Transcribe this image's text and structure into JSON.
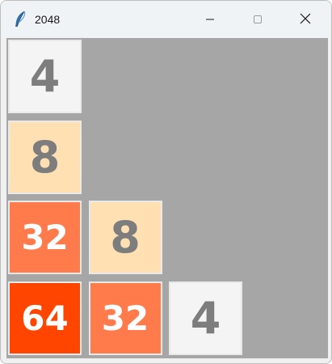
{
  "window": {
    "title": "2048",
    "icon": "feather-icon",
    "controls": [
      "minimize-icon",
      "maximize-icon",
      "close-icon"
    ]
  },
  "board": {
    "background": "#a6a6a6",
    "tiles": [
      {
        "id": "r0c0",
        "value": "4",
        "row": 0,
        "col": 0,
        "bg": "#f4f4f4",
        "color": "#7d7d7d"
      },
      {
        "id": "r1c0",
        "value": "8",
        "row": 1,
        "col": 0,
        "bg": "#ffe0b3",
        "color": "#7d7d7d"
      },
      {
        "id": "r2c0",
        "value": "32",
        "row": 2,
        "col": 0,
        "bg": "#ff7b4c",
        "color": "#ffffff"
      },
      {
        "id": "r2c1",
        "value": "8",
        "row": 2,
        "col": 1,
        "bg": "#ffe0b3",
        "color": "#7d7d7d"
      },
      {
        "id": "r3c0",
        "value": "64",
        "row": 3,
        "col": 0,
        "bg": "#ff4500",
        "color": "#ffffff"
      },
      {
        "id": "r3c1",
        "value": "32",
        "row": 3,
        "col": 1,
        "bg": "#ff7b4c",
        "color": "#ffffff"
      },
      {
        "id": "r3c2",
        "value": "4",
        "row": 3,
        "col": 2,
        "bg": "#f4f4f4",
        "color": "#7d7d7d"
      }
    ]
  }
}
